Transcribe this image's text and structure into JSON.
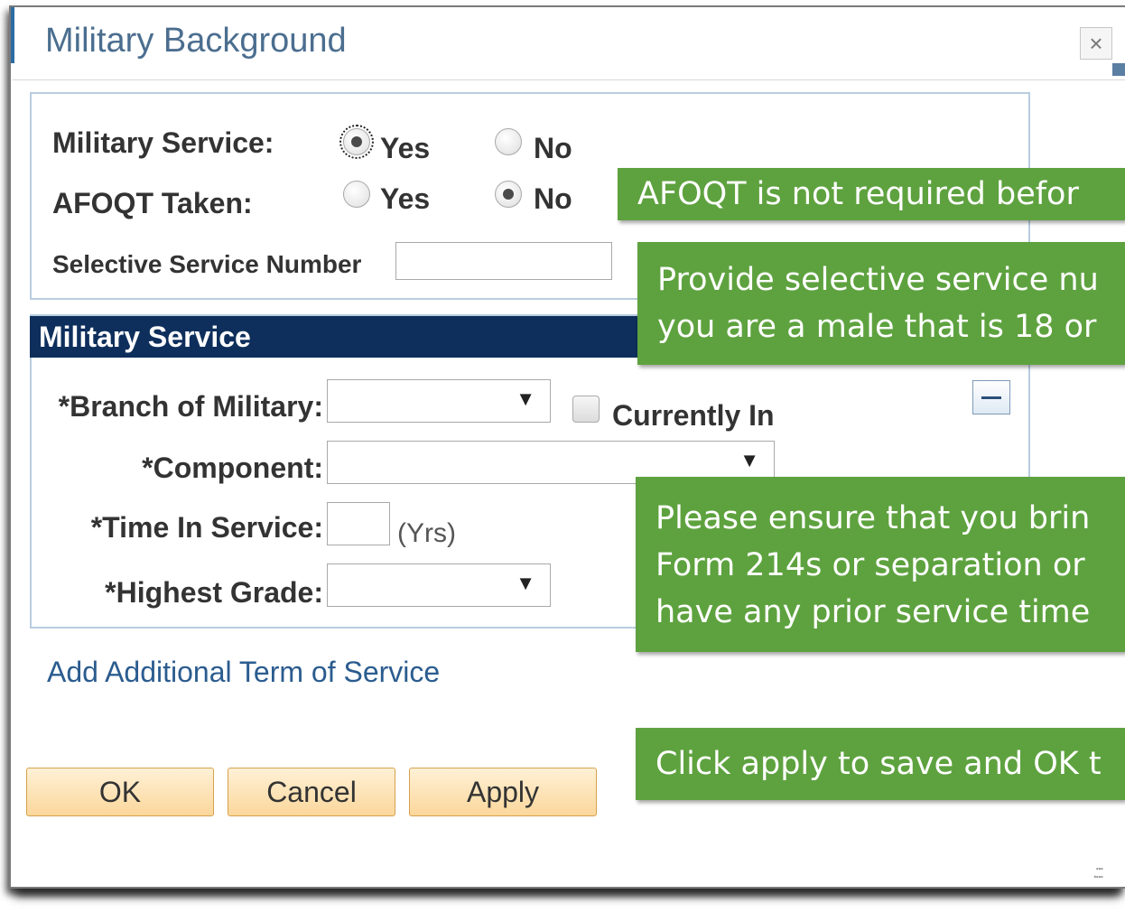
{
  "dialog": {
    "title": "Military Background",
    "close_glyph": "×",
    "close_icon": "close-icon"
  },
  "profile": {
    "military_service_label": "Military Service:",
    "military_service_options": [
      "Yes",
      "No"
    ],
    "military_service_selected": "Yes",
    "afoqt_label": "AFOQT Taken:",
    "afoqt_options": [
      "Yes",
      "No"
    ],
    "afoqt_selected": "No",
    "selective_service_label": "Selective Service Number",
    "selective_service_value": ""
  },
  "service_section": {
    "header": "Military Service",
    "branch_label": "*Branch of Military:",
    "branch_value": "",
    "currently_in_label": "Currently In",
    "currently_in_checked": false,
    "component_label": "*Component:",
    "component_value": "",
    "time_label": "*Time In Service:",
    "time_value": "",
    "time_unit": "(Yrs)",
    "grade_label": "*Highest Grade:",
    "grade_value": "",
    "dropdown_glyph": "▼",
    "collapse_icon": "minus-icon"
  },
  "add_term_link": "Add Additional Term of Service",
  "buttons": {
    "ok": "OK",
    "cancel": "Cancel",
    "apply": "Apply"
  },
  "callouts": {
    "afoqt": "AFOQT is not required befor",
    "selective_line1": "Provide selective service nu",
    "selective_line2": "you are a male that is 18 or",
    "bring_line1": "Please ensure that you brin",
    "bring_line2": "Form 214s or separation or",
    "bring_line3": "have any prior service time",
    "apply": "Click apply to save and OK t"
  },
  "colors": {
    "callout_green": "#5ea23f",
    "header_navy": "#0e2f5c",
    "button_orange": "#fbd79b",
    "link_blue": "#2b5c8f"
  }
}
